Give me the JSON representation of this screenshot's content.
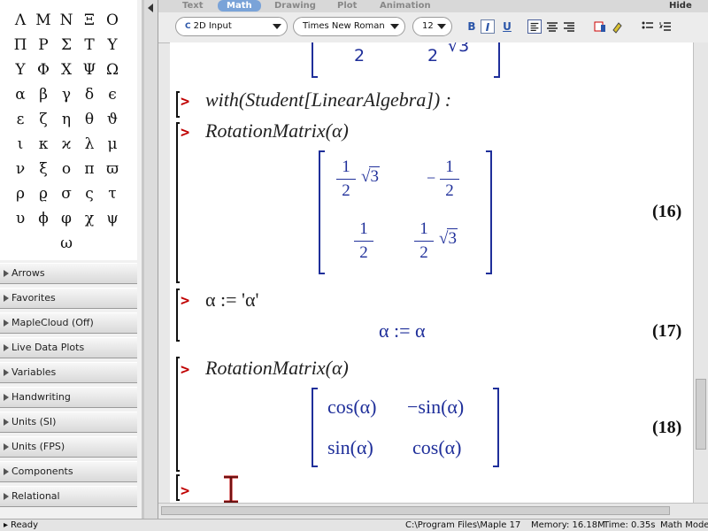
{
  "palette": {
    "greek_rows": [
      [
        "Λ",
        "Μ",
        "Ν",
        "Ξ",
        "Ο"
      ],
      [
        "Π",
        "Ρ",
        "Σ",
        "Τ",
        "Υ"
      ],
      [
        "Υ",
        "Φ",
        "Χ",
        "Ψ",
        "Ω"
      ],
      [
        "α",
        "β",
        "γ",
        "δ",
        "ϵ"
      ],
      [
        "ε",
        "ζ",
        "η",
        "θ",
        "ϑ"
      ],
      [
        "ι",
        "κ",
        "ϰ",
        "λ",
        "μ"
      ],
      [
        "ν",
        "ξ",
        "ο",
        "π",
        "ϖ"
      ],
      [
        "ρ",
        "ϱ",
        "σ",
        "ς",
        "τ"
      ],
      [
        "υ",
        "ϕ",
        "φ",
        "χ",
        "ψ"
      ],
      [
        "ω"
      ]
    ],
    "categories": [
      "Arrows",
      "Favorites",
      "MapleCloud (Off)",
      "Live Data Plots",
      "Variables",
      "Handwriting",
      "Units (SI)",
      "Units (FPS)",
      "Components",
      "Relational"
    ]
  },
  "toolbar": {
    "tabs": [
      "Text",
      "Math",
      "Drawing",
      "Plot",
      "Animation"
    ],
    "active_tab": "Math",
    "hide_label": "Hide",
    "mode_value": "2D Input",
    "font_value": "Times New Roman",
    "size_value": "12",
    "bold": "B",
    "italic": "I",
    "underline": "U"
  },
  "worksheet": {
    "partial_top": {
      "den1": "2",
      "den2": "2",
      "sqrt": "3"
    },
    "cmd1": "with(Student[LinearAlgebra]) :",
    "cmd2": "RotationMatrix(α)",
    "m16": {
      "r1c1": {
        "num": "1",
        "den": "2",
        "sqrt": "3"
      },
      "r1c2": {
        "sign": "−",
        "num": "1",
        "den": "2"
      },
      "r2c1": {
        "num": "1",
        "den": "2"
      },
      "r2c2": {
        "num": "1",
        "den": "2",
        "sqrt": "3"
      }
    },
    "label16": "(16)",
    "cmd3": "α := 'α'",
    "out17": "α := α",
    "label17": "(17)",
    "cmd4": "RotationMatrix(α)",
    "m18": {
      "r1c1": "cos(α)",
      "r1c2": "−sin(α)",
      "r2c1": "sin(α)",
      "r2c2": "cos(α)"
    },
    "label18": "(18)",
    "prompt": ">"
  },
  "statusbar": {
    "ready": "Ready",
    "path": "C:\\Program Files\\Maple 17",
    "memory": "Memory: 16.18M",
    "time": "Time: 0.35s",
    "mode": "Math Mode"
  }
}
